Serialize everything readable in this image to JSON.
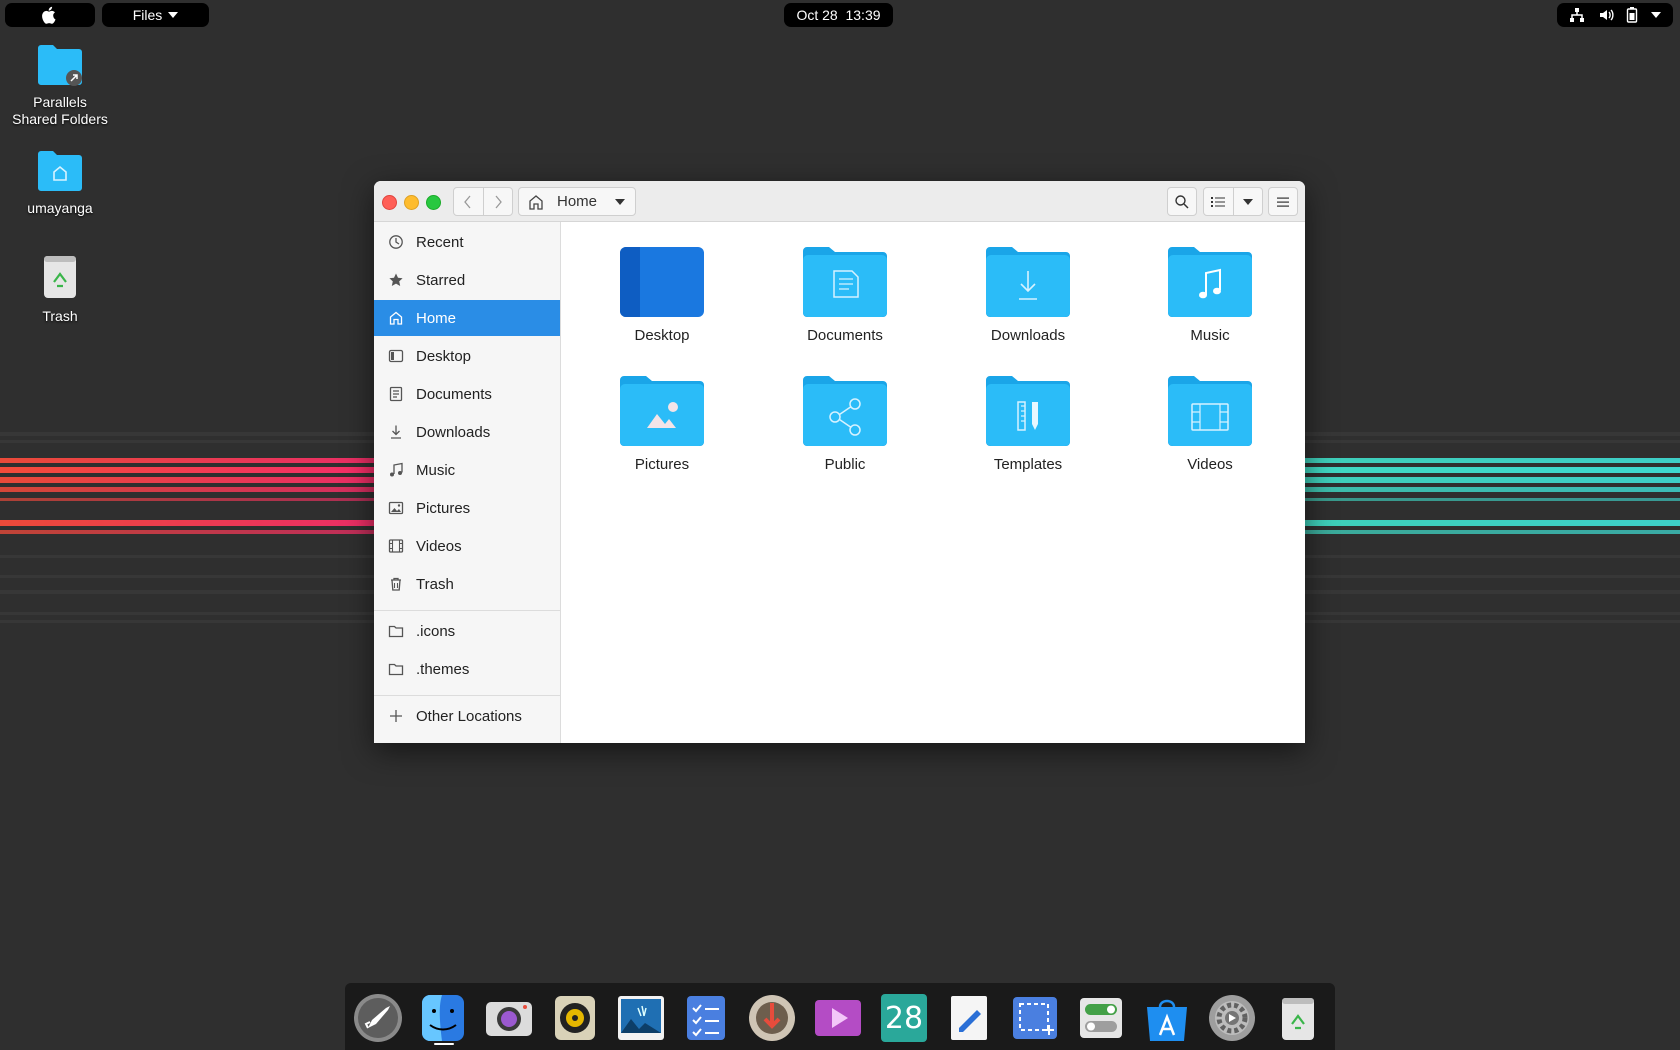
{
  "topbar": {
    "app_menu_label": "Files",
    "clock": "Oct 28  13:39"
  },
  "desktop": {
    "icons": [
      {
        "label": "Parallels\nShared Folders",
        "line1": "Parallels",
        "line2": "Shared Folders"
      },
      {
        "label": "umayanga"
      },
      {
        "label": "Trash"
      }
    ]
  },
  "window": {
    "path_label": "Home",
    "sidebar": {
      "items": [
        {
          "label": "Recent",
          "icon": "clock-icon"
        },
        {
          "label": "Starred",
          "icon": "star-icon"
        },
        {
          "label": "Home",
          "icon": "home-icon",
          "active": true
        },
        {
          "label": "Desktop",
          "icon": "desktop-icon"
        },
        {
          "label": "Documents",
          "icon": "document-icon"
        },
        {
          "label": "Downloads",
          "icon": "download-icon"
        },
        {
          "label": "Music",
          "icon": "music-icon"
        },
        {
          "label": "Pictures",
          "icon": "image-icon"
        },
        {
          "label": "Videos",
          "icon": "film-icon"
        },
        {
          "label": "Trash",
          "icon": "trash-icon"
        }
      ],
      "bookmarks": [
        {
          "label": ".icons",
          "icon": "folder-icon"
        },
        {
          "label": ".themes",
          "icon": "folder-icon"
        }
      ],
      "other_locations": "Other Locations"
    },
    "files": [
      {
        "label": "Desktop",
        "icon": "desktop-folder-icon"
      },
      {
        "label": "Documents",
        "icon": "documents-folder-icon"
      },
      {
        "label": "Downloads",
        "icon": "downloads-folder-icon"
      },
      {
        "label": "Music",
        "icon": "music-folder-icon"
      },
      {
        "label": "Pictures",
        "icon": "pictures-folder-icon"
      },
      {
        "label": "Public",
        "icon": "public-folder-icon"
      },
      {
        "label": "Templates",
        "icon": "templates-folder-icon"
      },
      {
        "label": "Videos",
        "icon": "videos-folder-icon"
      }
    ]
  },
  "dock": {
    "calendar_day": "28",
    "apps": [
      "launchpad-icon",
      "finder-icon",
      "camera-icon",
      "music-player-icon",
      "photos-icon",
      "tasks-icon",
      "installer-icon",
      "video-player-icon",
      "calendar-icon",
      "text-editor-icon",
      "screenshot-icon",
      "tweaks-icon",
      "app-store-icon",
      "settings-icon",
      "trash-icon"
    ]
  },
  "colors": {
    "accent": "#2a8de6",
    "folder": "#2bbcf8",
    "folder_dark": "#1aa5e8",
    "desktop_bg": "#2f2f2f"
  }
}
